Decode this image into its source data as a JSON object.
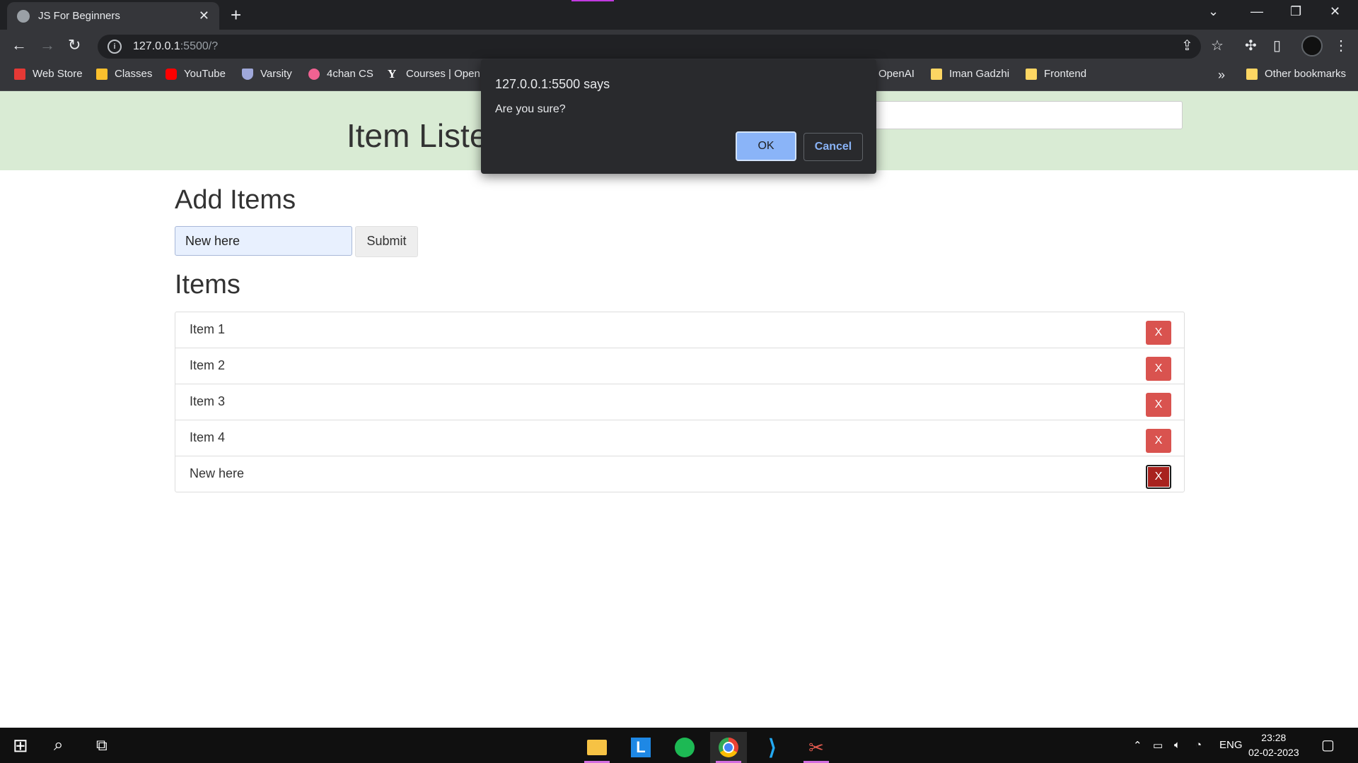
{
  "browser": {
    "tab_title": "JS For Beginners",
    "tab_close": "✕",
    "new_tab": "+",
    "url_host": "127.0.0.1",
    "url_rest": ":5500/?",
    "bookmarks": [
      {
        "label": "Web Store",
        "color": "#e53935"
      },
      {
        "label": "Classes",
        "color": "#fbc02d"
      },
      {
        "label": "YouTube",
        "color": "#ff0000"
      },
      {
        "label": "Varsity",
        "color": "#9fa8da"
      },
      {
        "label": "4chan CS",
        "color": "#f06292"
      },
      {
        "label": "Courses | Open",
        "color": "#ffffff"
      },
      {
        "label": "OpenAI",
        "color": "#35363a"
      },
      {
        "label": "Iman Gadzhi",
        "color": "#fdd663"
      },
      {
        "label": "Frontend",
        "color": "#fdd663"
      }
    ],
    "overflow": "»",
    "other_bookmarks": "Other bookmarks"
  },
  "header": {
    "title": "Item Lister"
  },
  "add_section": {
    "heading": "Add Items",
    "input_value": "New here",
    "submit_label": "Submit"
  },
  "items_section": {
    "heading": "Items",
    "items": [
      "Item 1",
      "Item 2",
      "Item 3",
      "Item 4",
      "New here"
    ],
    "delete_label": "X"
  },
  "dialog": {
    "title": "127.0.0.1:5500 says",
    "message": "Are you sure?",
    "ok_label": "OK",
    "cancel_label": "Cancel"
  },
  "taskbar": {
    "lang": "ENG",
    "time": "23:28",
    "date": "02-02-2023"
  }
}
